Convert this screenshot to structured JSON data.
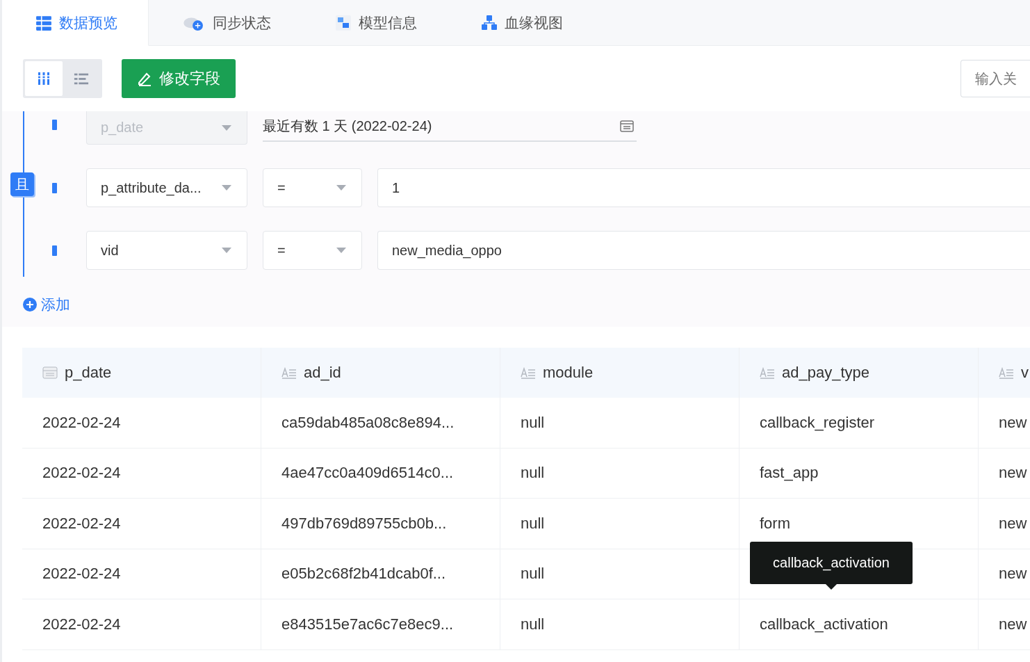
{
  "tabs": [
    {
      "label": "数据预览",
      "selected": true
    },
    {
      "label": "同步状态",
      "selected": false
    },
    {
      "label": "模型信息",
      "selected": false
    },
    {
      "label": "血缘视图",
      "selected": false
    }
  ],
  "view_toggle": [
    {
      "selected": true
    },
    {
      "selected": false
    }
  ],
  "edit_button": "修改字段",
  "search": {
    "placeholder": "输入关"
  },
  "filter": {
    "connector": "且",
    "add_label": "添加",
    "conditions": [
      {
        "kind": "date",
        "field": "p_date",
        "disabled": true,
        "value": "最近有数 1 天 (2022-02-24)"
      },
      {
        "kind": "compare",
        "field": "p_attribute_da...",
        "disabled": false,
        "operator": "=",
        "value": "1"
      },
      {
        "kind": "compare",
        "field": "vid",
        "disabled": false,
        "operator": "=",
        "value": "new_media_oppo"
      }
    ]
  },
  "table": {
    "columns": [
      {
        "label": "p_date"
      },
      {
        "label": "ad_id"
      },
      {
        "label": "module"
      },
      {
        "label": "ad_pay_type"
      },
      {
        "label": "v"
      }
    ],
    "rows": [
      {
        "cells": [
          "2022-02-24",
          "ca59dab485a08c8e894...",
          "null",
          "callback_register",
          "new"
        ]
      },
      {
        "cells": [
          "2022-02-24",
          "4ae47cc0a409d6514c0...",
          "null",
          "fast_app",
          "new"
        ]
      },
      {
        "cells": [
          "2022-02-24",
          "497db769d89755cb0b...",
          "null",
          "form",
          "new"
        ]
      },
      {
        "cells": [
          "2022-02-24",
          "e05b2c68f2b41dcab0f...",
          "null",
          {
            "tooltip": "callback_activation"
          },
          "new"
        ]
      },
      {
        "cells": [
          "2022-02-24",
          "e843515e7ac6c7e8ec9...",
          "null",
          "callback_activation",
          "new"
        ]
      }
    ]
  }
}
